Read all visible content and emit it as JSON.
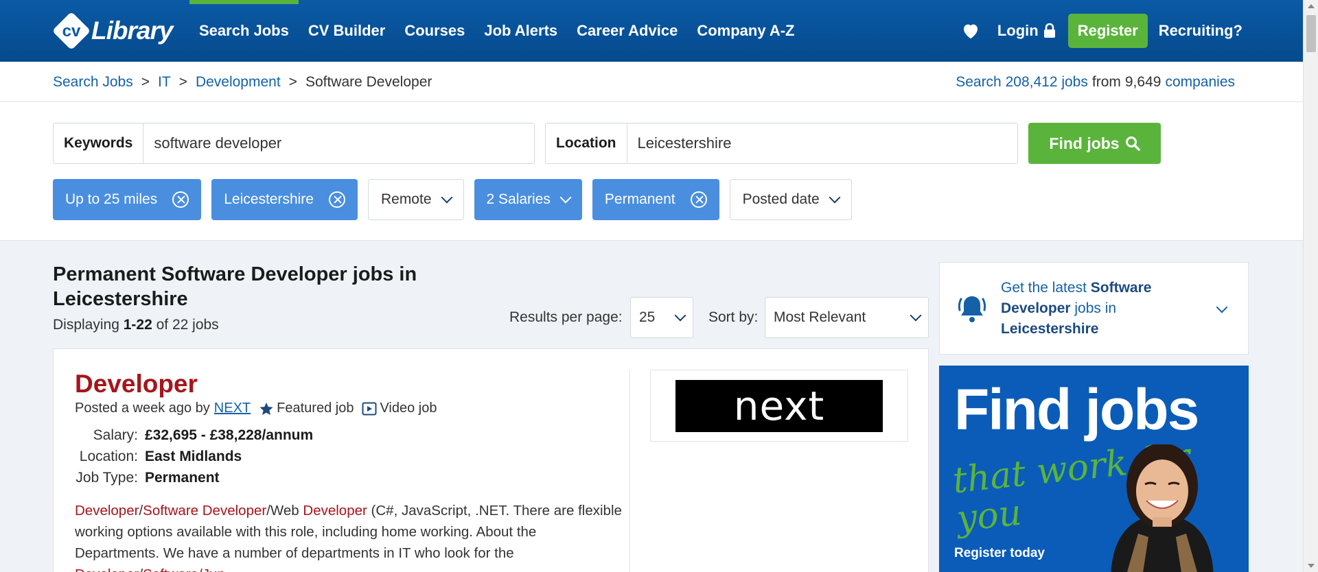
{
  "header": {
    "logo_text": "CVLibrary",
    "nav": [
      "Search Jobs",
      "CV Builder",
      "Courses",
      "Job Alerts",
      "Career Advice",
      "Company A-Z"
    ],
    "login": "Login",
    "register": "Register",
    "recruiting": "Recruiting?",
    "accent": "#5ab43b",
    "brand": "#0a5aa6"
  },
  "breadcrumb": {
    "items": [
      "Search Jobs",
      "IT",
      "Development"
    ],
    "current": "Software Developer",
    "sep": ">"
  },
  "stats": {
    "prefix": "Search",
    "jobs": "208,412 jobs",
    "from": "from",
    "companies_count": "9,649",
    "companies": "companies"
  },
  "search": {
    "keywords_label": "Keywords",
    "keywords_value": "software developer",
    "location_label": "Location",
    "location_value": "Leicestershire",
    "find_button": "Find jobs"
  },
  "filters": [
    {
      "label": "Up to 25 miles",
      "active": true,
      "kind": "remove"
    },
    {
      "label": "Leicestershire",
      "active": true,
      "kind": "remove"
    },
    {
      "label": "Remote",
      "active": false,
      "kind": "dropdown"
    },
    {
      "label": "2 Salaries",
      "active": true,
      "kind": "dropdown"
    },
    {
      "label": "Permanent",
      "active": true,
      "kind": "remove"
    },
    {
      "label": "Posted date",
      "active": false,
      "kind": "dropdown"
    }
  ],
  "results": {
    "title": "Permanent Software Developer jobs in Leicestershire",
    "displaying_prefix": "Displaying",
    "range": "1-22",
    "of_text": "of 22 jobs",
    "per_page_label": "Results per page:",
    "per_page_value": "25",
    "sort_label": "Sort by:",
    "sort_value": "Most Relevant"
  },
  "job": {
    "title": "Developer",
    "posted": "Posted a week ago by",
    "company": "NEXT",
    "featured": "Featured job",
    "video": "Video job",
    "salary_label": "Salary:",
    "salary": "£32,695 - £38,228/annum",
    "location_label": "Location:",
    "location": "East Midlands",
    "type_label": "Job Type:",
    "type": "Permanent",
    "desc_hl1": "Developer",
    "desc_sep1": "/",
    "desc_hl2": "Software Developer",
    "desc_mid": "/Web",
    "desc_hl3": "Developer",
    "desc_rest": "(C#, JavaScript, .NET. There are flexible working options available with this role, including home working. About the Departments. We have a number of departments in IT who look for the",
    "desc_hl4": "Developer",
    "desc_sep2": "/",
    "desc_hl5": "Software",
    "desc_tail": "/Jun...",
    "logo_text": "next"
  },
  "alert": {
    "prefix": "Get the latest",
    "bold1": "Software Developer",
    "mid": "jobs in",
    "bold2": "Leicestershire"
  },
  "ad": {
    "headline": "Find jobs",
    "script": "that work for you",
    "cta": "Register today"
  }
}
